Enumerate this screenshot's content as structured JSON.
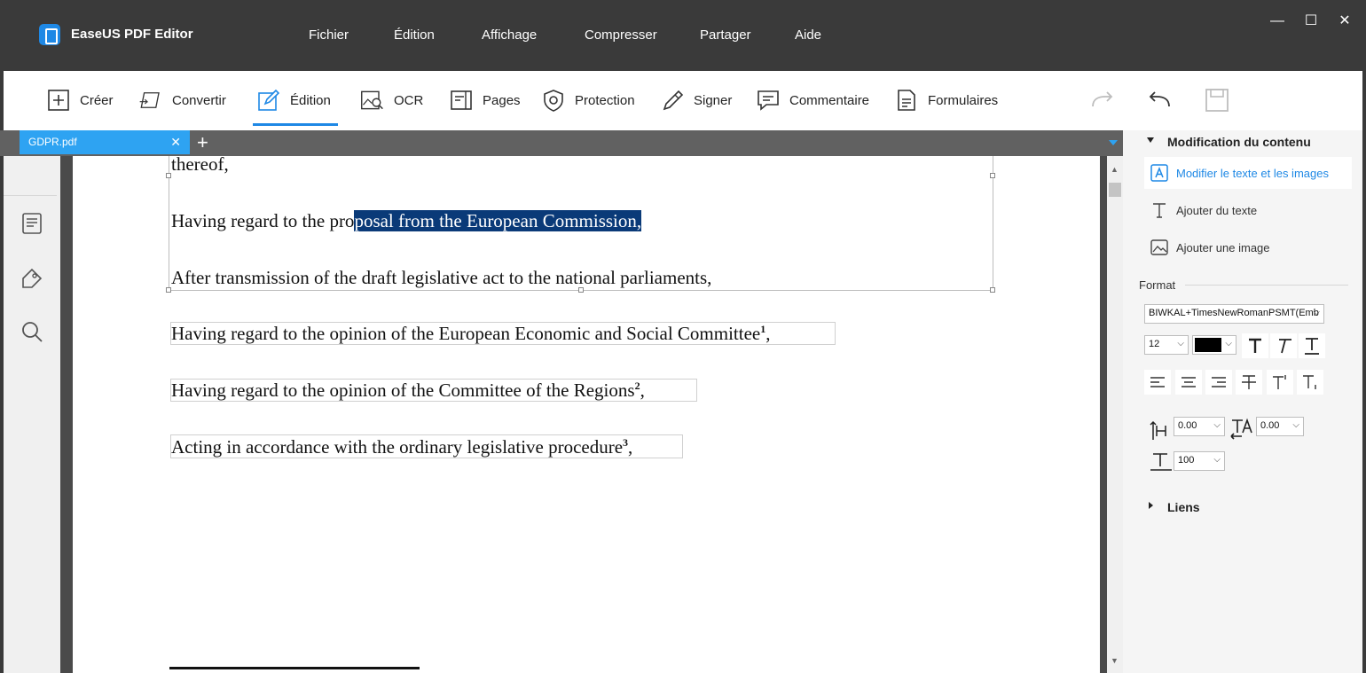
{
  "window": {
    "title": "EaseUS PDF Editor",
    "menu": [
      "Fichier",
      "Édition",
      "Affichage",
      "Compresser",
      "Partager",
      "Aide"
    ],
    "controls": {
      "minimize": "—",
      "maximize": "☐",
      "close": "✕"
    }
  },
  "toolbar": {
    "tools": [
      {
        "label": "Créer",
        "icon": "plus-box-icon"
      },
      {
        "label": "Convertir",
        "icon": "convert-icon"
      },
      {
        "label": "Édition",
        "icon": "edit-pen-icon",
        "active": true
      },
      {
        "label": "OCR",
        "icon": "ocr-icon"
      },
      {
        "label": "Pages",
        "icon": "pages-icon"
      },
      {
        "label": "Protection",
        "icon": "shield-icon"
      },
      {
        "label": "Signer",
        "icon": "pen-icon"
      },
      {
        "label": "Commentaire",
        "icon": "comment-icon"
      },
      {
        "label": "Formulaires",
        "icon": "form-icon"
      }
    ],
    "right_icons": [
      "redo-icon",
      "undo-icon",
      "save-icon"
    ]
  },
  "tabs": [
    {
      "label": "GDPR.pdf",
      "close": "✕"
    }
  ],
  "tab_add": "+",
  "document": {
    "line1": "thereof,",
    "line2_pre": "Having regard to the pro",
    "line2_sel": "posal from the European Commission,",
    "line3": "After transmission of the draft legislative act to the national parliaments,",
    "line4": "Having regard to the opinion of the European Economic and Social Committee",
    "line4_sup": "1",
    "line5": "Having regard to the opinion of the Committee of the Regions",
    "line5_sup": "2",
    "line6": "Acting in accordance with the ordinary legislative procedure",
    "line6_sup": "3",
    "comma": ","
  },
  "right_panel": {
    "section_title": "Modification du contenu",
    "items": [
      {
        "label": "Modifier le texte et les images",
        "active": true
      },
      {
        "label": "Ajouter du texte"
      },
      {
        "label": "Ajouter une image"
      }
    ],
    "format_label": "Format",
    "font": "BIWKAL+TimesNewRomanPSMT(Emb",
    "size": "12",
    "color": "#000000",
    "char_spacing": "0.00",
    "word_spacing": "0.00",
    "scale": "100",
    "links_title": "Liens"
  },
  "colors": {
    "accent": "#1e88e5",
    "titlebar": "#3a3a3a",
    "selection": "#0a3a78"
  }
}
